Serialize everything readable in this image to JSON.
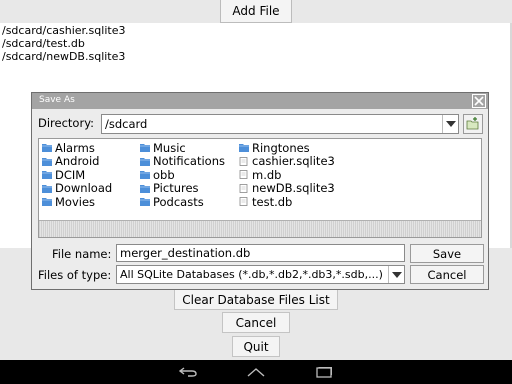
{
  "app": {
    "add_file_label": "Add File",
    "files": [
      "/sdcard/cashier.sqlite3",
      "/sdcard/test.db",
      "/sdcard/newDB.sqlite3"
    ],
    "clear_list_label": "Clear Database Files List",
    "cancel_label": "Cancel",
    "quit_label": "Quit"
  },
  "dialog": {
    "title": "Save As",
    "directory_label": "Directory:",
    "directory_value": "/sdcard",
    "entries": {
      "col1": [
        {
          "name": "Alarms",
          "icon": "folder-icon"
        },
        {
          "name": "Android",
          "icon": "folder-icon"
        },
        {
          "name": "DCIM",
          "icon": "folder-icon"
        },
        {
          "name": "Download",
          "icon": "folder-icon"
        },
        {
          "name": "Movies",
          "icon": "folder-icon"
        }
      ],
      "col2": [
        {
          "name": "Music",
          "icon": "folder-icon"
        },
        {
          "name": "Notifications",
          "icon": "folder-icon"
        },
        {
          "name": "obb",
          "icon": "folder-icon"
        },
        {
          "name": "Pictures",
          "icon": "folder-icon"
        },
        {
          "name": "Podcasts",
          "icon": "folder-icon"
        }
      ],
      "col3": [
        {
          "name": "Ringtones",
          "icon": "folder-icon"
        },
        {
          "name": "cashier.sqlite3",
          "icon": "file-icon"
        },
        {
          "name": "m.db",
          "icon": "file-icon"
        },
        {
          "name": "newDB.sqlite3",
          "icon": "file-icon"
        },
        {
          "name": "test.db",
          "icon": "file-icon"
        }
      ]
    },
    "file_name_label": "File name:",
    "file_name_value": "merger_destination.db",
    "file_type_label": "Files of type:",
    "file_type_value": "All SQLite Databases (*.db,*.db2,*.db3,*.sdb,...)",
    "save_label": "Save",
    "cancel_label": "Cancel"
  },
  "colors": {
    "folder": "#4d8fd9",
    "title_bar": "#a4a4a4",
    "nav_bar": "#000000"
  }
}
